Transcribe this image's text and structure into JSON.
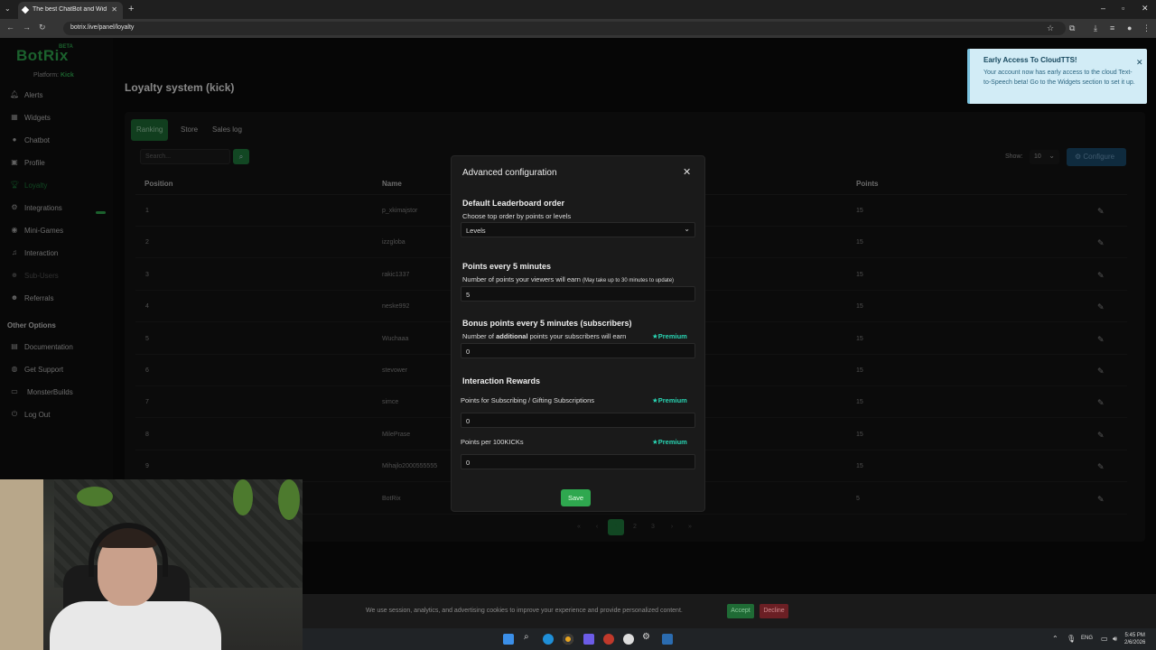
{
  "browser": {
    "tab_title": "The best ChatBot and Widgets",
    "url": "botrix.live/panel/loyalty"
  },
  "sidebar": {
    "logo": "BotRix",
    "beta": "BETA",
    "platform_label": "Platform:",
    "platform_value": "Kick",
    "items": [
      {
        "label": "Alerts",
        "icon": "bell-icon"
      },
      {
        "label": "Widgets",
        "icon": "widgets-icon"
      },
      {
        "label": "Chatbot",
        "icon": "chat-icon"
      },
      {
        "label": "Profile",
        "icon": "profile-icon"
      },
      {
        "label": "Loyalty",
        "icon": "trophy-icon"
      },
      {
        "label": "Integrations",
        "icon": "integrations-icon"
      },
      {
        "label": "Mini-Games",
        "icon": "gamepad-icon"
      },
      {
        "label": "Interaction",
        "icon": "music-icon"
      },
      {
        "label": "Sub-Users",
        "icon": "users-icon"
      },
      {
        "label": "Referrals",
        "icon": "referrals-icon"
      }
    ],
    "other_options_title": "Other Options",
    "other_items": [
      {
        "label": "Documentation",
        "icon": "book-icon"
      },
      {
        "label": "Get Support",
        "icon": "support-icon"
      },
      {
        "label": "MonsterBuilds",
        "icon": "monitor-icon"
      },
      {
        "label": "Log Out",
        "icon": "logout-icon"
      }
    ]
  },
  "main": {
    "page_title": "Loyalty system (kick)",
    "tabs": [
      "Ranking",
      "Store",
      "Sales log"
    ],
    "search_placeholder": "Search...",
    "show_label": "Show:",
    "show_value": "10",
    "configure_label": "Configure",
    "columns": {
      "position": "Position",
      "name": "Name",
      "points": "Points"
    },
    "rows": [
      {
        "position": "1",
        "name": "p_xkimajstor",
        "points": "15"
      },
      {
        "position": "2",
        "name": "izzgloba",
        "points": "15"
      },
      {
        "position": "3",
        "name": "rakic1337",
        "points": "15"
      },
      {
        "position": "4",
        "name": "neske992",
        "points": "15"
      },
      {
        "position": "5",
        "name": "Wuchaaa",
        "points": "15"
      },
      {
        "position": "6",
        "name": "stevower",
        "points": "15"
      },
      {
        "position": "7",
        "name": "simce",
        "points": "15"
      },
      {
        "position": "8",
        "name": "MilePrase",
        "points": "15"
      },
      {
        "position": "9",
        "name": "Mihajlo2000555555",
        "points": "15"
      },
      {
        "position": "10",
        "name": "BotRix",
        "points": "5"
      }
    ],
    "pagination": [
      "«",
      "‹",
      "1",
      "2",
      "3",
      "›",
      "»"
    ]
  },
  "modal": {
    "title": "Advanced configuration",
    "sections": {
      "leaderboard_title": "Default Leaderboard order",
      "leaderboard_sub": "Choose top order by points or levels",
      "leaderboard_value": "Levels",
      "points_title": "Points every 5 minutes",
      "points_sub": "Number of points your viewers will earn",
      "points_note": "(May take up to 30 minutes to update)",
      "points_value": "5",
      "bonus_title": "Bonus points every 5 minutes (subscribers)",
      "bonus_sub_pre": "Number of",
      "bonus_sub_bold": "additional",
      "bonus_sub_post": "points your subscribers will earn",
      "bonus_value": "0",
      "rewards_title": "Interaction Rewards",
      "subs_label": "Points for Subscribing / Gifting Subscriptions",
      "subs_value": "0",
      "kicks_label": "Points per 100KICKs",
      "kicks_value": "0"
    },
    "premium_label": "Premium",
    "save_label": "Save"
  },
  "toast": {
    "title": "Early Access To CloudTTS!",
    "body": "Your account now has early access to the cloud Text-to-Speech beta! Go to the Widgets section to set it up."
  },
  "cookie": {
    "text": "We use session, analytics, and advertising cookies to improve your experience and provide personalized content.",
    "accept": "Accept",
    "decline": "Decline"
  },
  "taskbar": {
    "lang": "ENG",
    "time": "5:45 PM",
    "date": "2/6/2026"
  },
  "colors": {
    "accent": "#2fa84f",
    "premium": "#29d6b4",
    "toast_bg": "#d2ecf6"
  }
}
